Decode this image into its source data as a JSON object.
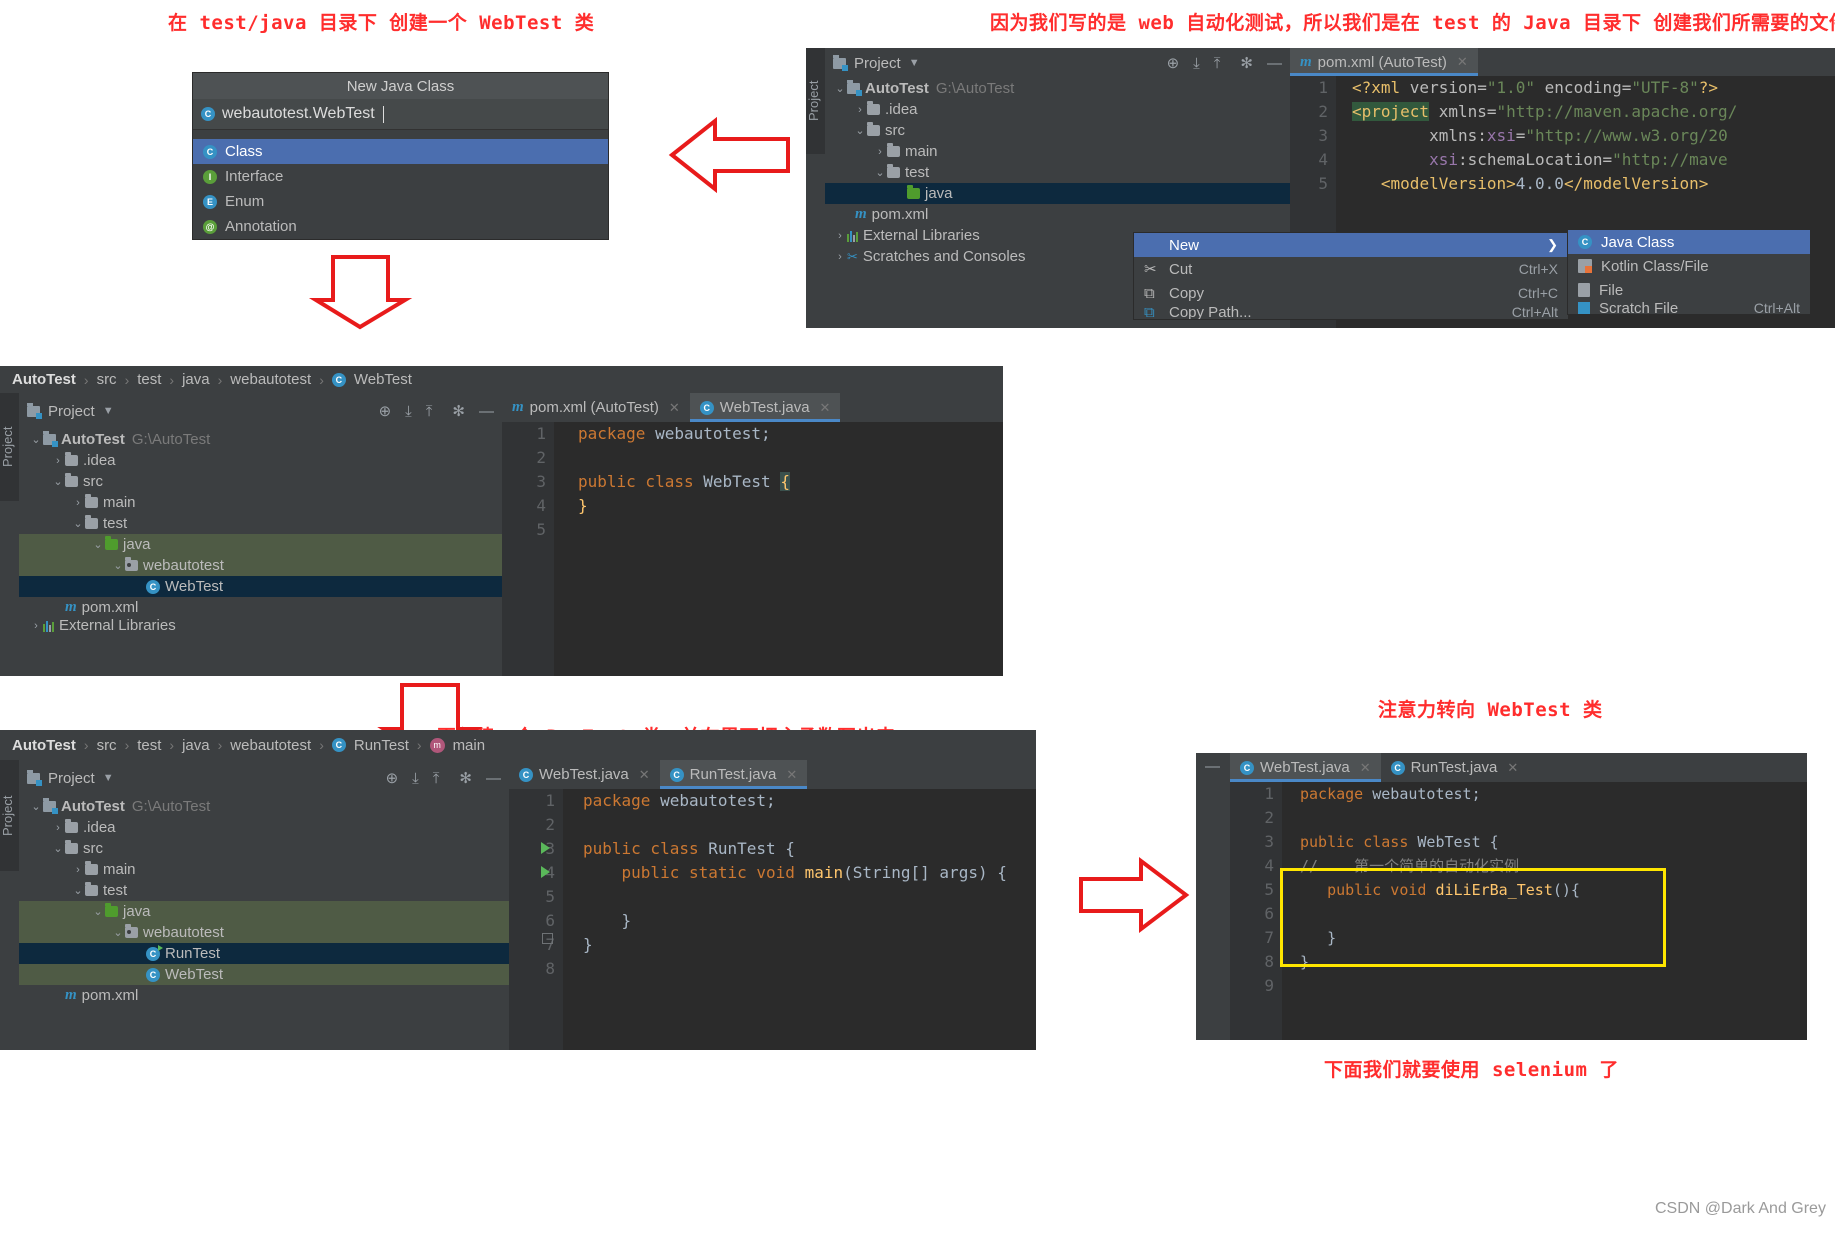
{
  "annotations": {
    "top_left": "在 test/java 目录下 创建一个 WebTest 类",
    "top_right": "因为我们写的是 web 自动化测试，所以我们是在 test 的 Java 目录下 创建我们所需要的文件",
    "mid_bottom": "再创建一个 RunTest 类，并在里面把主函数写出来",
    "right_mid": "注意力转向 WebTest 类",
    "right_bottom": "下面我们就要使用 selenium 了",
    "watermark": "CSDN @Dark And Grey"
  },
  "new_class_dialog": {
    "title": "New Java Class",
    "input_value": "webautotest.WebTest",
    "input_icon": "class-icon",
    "options": [
      {
        "label": "Class",
        "icon": "class-icon",
        "selected": true
      },
      {
        "label": "Interface",
        "icon": "interface-icon",
        "selected": false
      },
      {
        "label": "Enum",
        "icon": "enum-icon",
        "selected": false
      },
      {
        "label": "Annotation",
        "icon": "annotation-icon",
        "selected": false
      }
    ]
  },
  "panel_top_right": {
    "tool_window": {
      "vertical_tab": "Project",
      "title": "Project",
      "icons": [
        "locate-icon",
        "expand-all-icon",
        "collapse-all-icon",
        "gear-icon",
        "minimize-icon"
      ]
    },
    "tree": [
      {
        "label": "AutoTest",
        "path_hint": "G:\\AutoTest",
        "indent": 0,
        "arrow": "v",
        "icon": "project-icon",
        "state": "normal"
      },
      {
        "label": ".idea",
        "indent": 1,
        "arrow": ">",
        "icon": "folder-icon",
        "state": "normal"
      },
      {
        "label": "src",
        "indent": 1,
        "arrow": "v",
        "icon": "folder-icon",
        "state": "normal"
      },
      {
        "label": "main",
        "indent": 2,
        "arrow": ">",
        "icon": "folder-icon",
        "state": "normal"
      },
      {
        "label": "test",
        "indent": 2,
        "arrow": "v",
        "icon": "folder-icon",
        "state": "normal"
      },
      {
        "label": "java",
        "indent": 3,
        "arrow": "",
        "icon": "folder-green-icon",
        "state": "selected-blue"
      },
      {
        "label": "pom.xml",
        "indent": 1,
        "arrow": "",
        "icon": "maven-icon",
        "state": "normal"
      },
      {
        "label": "External Libraries",
        "indent": 0,
        "arrow": ">",
        "icon": "libraries-icon",
        "state": "normal"
      },
      {
        "label": "Scratches and Consoles",
        "indent": 0,
        "arrow": ">",
        "icon": "scratches-icon",
        "state": "normal"
      }
    ],
    "editor_tab": {
      "label": "pom.xml (AutoTest)",
      "icon": "maven-icon"
    },
    "code_lines": [
      {
        "n": "1",
        "text": "<?xml version=\"1.0\" encoding=\"UTF-8\"?>"
      },
      {
        "n": "2",
        "text": "<project xmlns=\"http://maven.apache.org/"
      },
      {
        "n": "3",
        "text": "xmlns:xsi=\"http://www.w3.org/20"
      },
      {
        "n": "4",
        "text": "xsi:schemaLocation=\"http://mave"
      },
      {
        "n": "5",
        "text": "<modelVersion>4.0.0</modelVersion>"
      }
    ],
    "context_menu": [
      {
        "label": "New",
        "shortcut": "",
        "selected": true,
        "submenu": true,
        "icon": ""
      },
      {
        "label": "Cut",
        "shortcut": "Ctrl+X",
        "selected": false,
        "icon": "cut-icon"
      },
      {
        "label": "Copy",
        "shortcut": "Ctrl+C",
        "selected": false,
        "icon": "copy-icon"
      },
      {
        "label": "Copy Path...",
        "shortcut": "Ctrl+Alt",
        "selected": false,
        "icon": "copy-path-icon"
      }
    ],
    "submenu": [
      {
        "label": "Java Class",
        "icon": "class-icon",
        "selected": true
      },
      {
        "label": "Kotlin Class/File",
        "icon": "kotlin-icon",
        "selected": false
      },
      {
        "label": "File",
        "icon": "file-icon",
        "selected": false
      },
      {
        "label": "Scratch File",
        "icon": "scratch-icon",
        "selected": false,
        "shortcut": "Ctrl+Alt"
      }
    ]
  },
  "panel_middle": {
    "breadcrumb": [
      "AutoTest",
      "src",
      "test",
      "java",
      "webautotest",
      "WebTest"
    ],
    "breadcrumb_last_icon": "class-icon",
    "tool_window": {
      "vertical_tab": "Project",
      "title": "Project"
    },
    "tree": [
      {
        "label": "AutoTest",
        "path_hint": "G:\\AutoTest",
        "indent": 0,
        "arrow": "v",
        "icon": "project-icon",
        "state": "normal"
      },
      {
        "label": ".idea",
        "indent": 1,
        "arrow": ">",
        "icon": "folder-icon",
        "state": "normal"
      },
      {
        "label": "src",
        "indent": 1,
        "arrow": "v",
        "icon": "folder-icon",
        "state": "normal"
      },
      {
        "label": "main",
        "indent": 2,
        "arrow": ">",
        "icon": "folder-icon",
        "state": "normal"
      },
      {
        "label": "test",
        "indent": 2,
        "arrow": "v",
        "icon": "folder-icon",
        "state": "normal"
      },
      {
        "label": "java",
        "indent": 3,
        "arrow": "v",
        "icon": "folder-green-icon",
        "state": "selected-green"
      },
      {
        "label": "webautotest",
        "indent": 4,
        "arrow": "v",
        "icon": "package-icon",
        "state": "selected-green"
      },
      {
        "label": "WebTest",
        "indent": 5,
        "arrow": "",
        "icon": "class-icon",
        "state": "selected-blue"
      },
      {
        "label": "pom.xml",
        "indent": 1,
        "arrow": "",
        "icon": "maven-icon",
        "state": "normal"
      },
      {
        "label": "External Libraries",
        "indent": 0,
        "arrow": ">",
        "icon": "libraries-icon",
        "state": "normal"
      }
    ],
    "tabs": [
      {
        "label": "pom.xml (AutoTest)",
        "icon": "maven-icon",
        "active": false
      },
      {
        "label": "WebTest.java",
        "icon": "class-icon",
        "active": true
      }
    ],
    "code_lines": [
      {
        "n": "1",
        "text": "package webautotest;"
      },
      {
        "n": "2",
        "text": ""
      },
      {
        "n": "3",
        "text": "public class WebTest {"
      },
      {
        "n": "4",
        "text": "}"
      },
      {
        "n": "5",
        "text": ""
      }
    ]
  },
  "panel_bottom_left": {
    "breadcrumb": [
      "AutoTest",
      "src",
      "test",
      "java",
      "webautotest",
      "RunTest",
      "main"
    ],
    "tool_window": {
      "vertical_tab": "Project",
      "title": "Project"
    },
    "tree": [
      {
        "label": "AutoTest",
        "path_hint": "G:\\AutoTest",
        "indent": 0,
        "arrow": "v",
        "icon": "project-icon",
        "state": "normal"
      },
      {
        "label": ".idea",
        "indent": 1,
        "arrow": ">",
        "icon": "folder-icon",
        "state": "normal"
      },
      {
        "label": "src",
        "indent": 1,
        "arrow": "v",
        "icon": "folder-icon",
        "state": "normal"
      },
      {
        "label": "main",
        "indent": 2,
        "arrow": ">",
        "icon": "folder-icon",
        "state": "normal"
      },
      {
        "label": "test",
        "indent": 2,
        "arrow": "v",
        "icon": "folder-icon",
        "state": "normal"
      },
      {
        "label": "java",
        "indent": 3,
        "arrow": "v",
        "icon": "folder-green-icon",
        "state": "selected-green"
      },
      {
        "label": "webautotest",
        "indent": 4,
        "arrow": "v",
        "icon": "package-icon",
        "state": "selected-green"
      },
      {
        "label": "RunTest",
        "indent": 5,
        "arrow": "",
        "icon": "runnable-class-icon",
        "state": "selected-blue"
      },
      {
        "label": "WebTest",
        "indent": 5,
        "arrow": "",
        "icon": "class-icon",
        "state": "selected-green"
      },
      {
        "label": "pom.xml",
        "indent": 1,
        "arrow": "",
        "icon": "maven-icon",
        "state": "normal"
      }
    ],
    "tabs": [
      {
        "label": "WebTest.java",
        "icon": "class-icon",
        "active": false
      },
      {
        "label": "RunTest.java",
        "icon": "runnable-class-icon",
        "active": true
      }
    ],
    "code_lines": [
      {
        "n": "1",
        "text": "package webautotest;"
      },
      {
        "n": "2",
        "text": ""
      },
      {
        "n": "3",
        "text": "public class RunTest {"
      },
      {
        "n": "4",
        "text": "public static void main(String[] args) {"
      },
      {
        "n": "5",
        "text": ""
      },
      {
        "n": "6",
        "text": "}"
      },
      {
        "n": "7",
        "text": "}"
      },
      {
        "n": "8",
        "text": ""
      }
    ]
  },
  "panel_bottom_right": {
    "tabs": [
      {
        "label": "WebTest.java",
        "icon": "class-icon",
        "active": true
      },
      {
        "label": "RunTest.java",
        "icon": "runnable-class-icon",
        "active": false
      }
    ],
    "code_lines": [
      {
        "n": "1",
        "text": "package webautotest;"
      },
      {
        "n": "2",
        "text": ""
      },
      {
        "n": "3",
        "text": "public class WebTest {"
      },
      {
        "n": "4",
        "text": "//    第一个简单的自动化实例"
      },
      {
        "n": "5",
        "text": "public void diLiErBa_Test(){"
      },
      {
        "n": "6",
        "text": ""
      },
      {
        "n": "7",
        "text": "}"
      },
      {
        "n": "8",
        "text": "}"
      },
      {
        "n": "9",
        "text": ""
      }
    ],
    "highlight_box": "yellow"
  },
  "colors": {
    "accent_blue": "#4b6eaf",
    "ide_bg": "#3c3f41",
    "editor_bg": "#2b2b2b",
    "selection_blue": "#0d293e",
    "selection_green": "#4f5b45",
    "annotation_red": "#ff2d2d",
    "highlight_yellow": "#ffe600"
  }
}
